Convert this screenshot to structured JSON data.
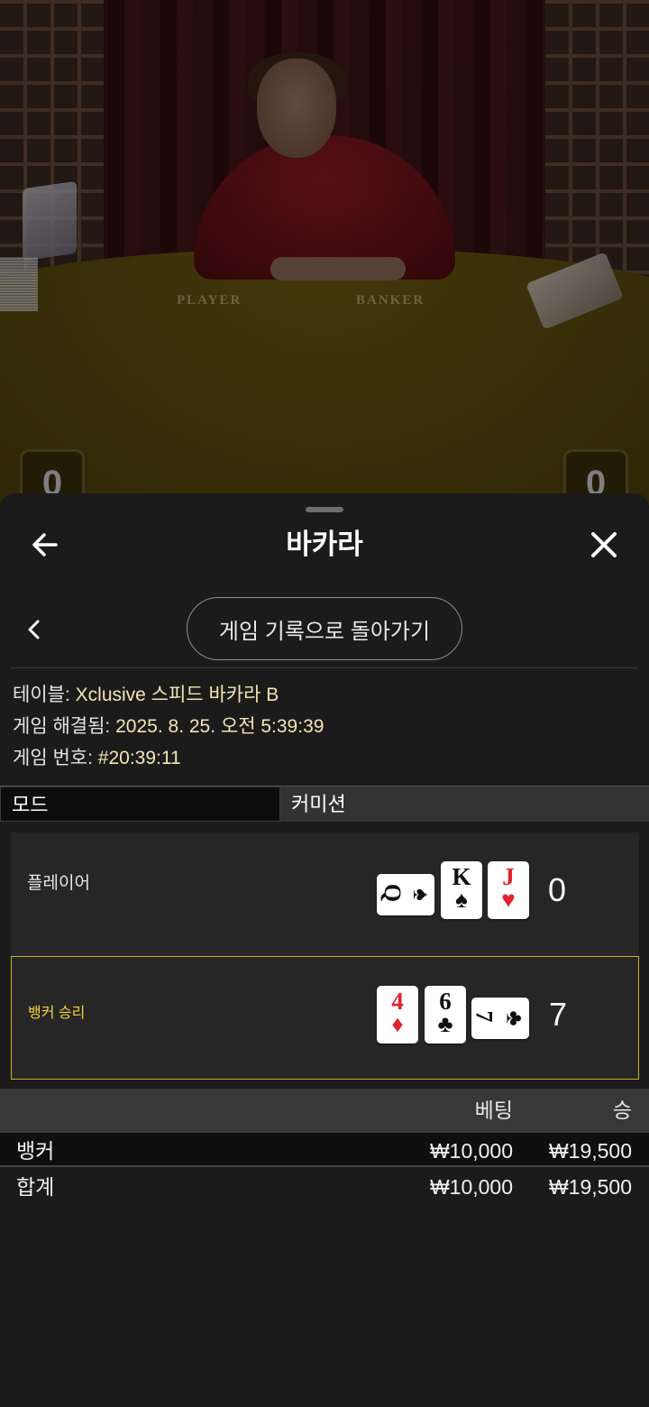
{
  "video": {
    "table_labels": [
      "PLAYER",
      "BANKER"
    ],
    "score_left": "0",
    "score_right": "0"
  },
  "header": {
    "title": "바카라",
    "back_icon": "arrow-left-icon",
    "close_icon": "close-icon"
  },
  "nav": {
    "chevron_icon": "chevron-left-icon",
    "back_to_history_label": "게임 기록으로 돌아가기"
  },
  "info": {
    "table_label": "테이블:",
    "table_value": "Xclusive 스피드 바카라 B",
    "resolved_label": "게임 해결됨:",
    "resolved_value": "2025. 8. 25. 오전 5:39:39",
    "game_no_label": "게임 번호:",
    "game_no_value": "#20:39:11"
  },
  "mode": {
    "label": "모드",
    "value": "커미션"
  },
  "hands": {
    "player": {
      "label": "플레이어",
      "score": "0",
      "cards": [
        {
          "rank": "Q",
          "suit": "♠",
          "color": "black",
          "orientation": "horizontal"
        },
        {
          "rank": "K",
          "suit": "♠",
          "color": "black",
          "orientation": "vertical"
        },
        {
          "rank": "J",
          "suit": "♥",
          "color": "red",
          "orientation": "vertical"
        }
      ]
    },
    "banker": {
      "label": "뱅커 승리",
      "score": "7",
      "cards": [
        {
          "rank": "4",
          "suit": "♦",
          "color": "red",
          "orientation": "vertical"
        },
        {
          "rank": "6",
          "suit": "♣",
          "color": "black",
          "orientation": "vertical"
        },
        {
          "rank": "7",
          "suit": "♣",
          "color": "black",
          "orientation": "horizontal"
        }
      ]
    }
  },
  "bets": {
    "col_bet": "베팅",
    "col_win": "승",
    "rows": [
      {
        "name": "뱅커",
        "bet": "₩10,000",
        "win": "₩19,500"
      },
      {
        "name": "합계",
        "bet": "₩10,000",
        "win": "₩19,500"
      }
    ]
  },
  "colors": {
    "sheet_bg": "#1b1b1b",
    "win_accent": "#f4d43b",
    "info_value": "#f3e6b2",
    "card_red": "#e0232b"
  }
}
